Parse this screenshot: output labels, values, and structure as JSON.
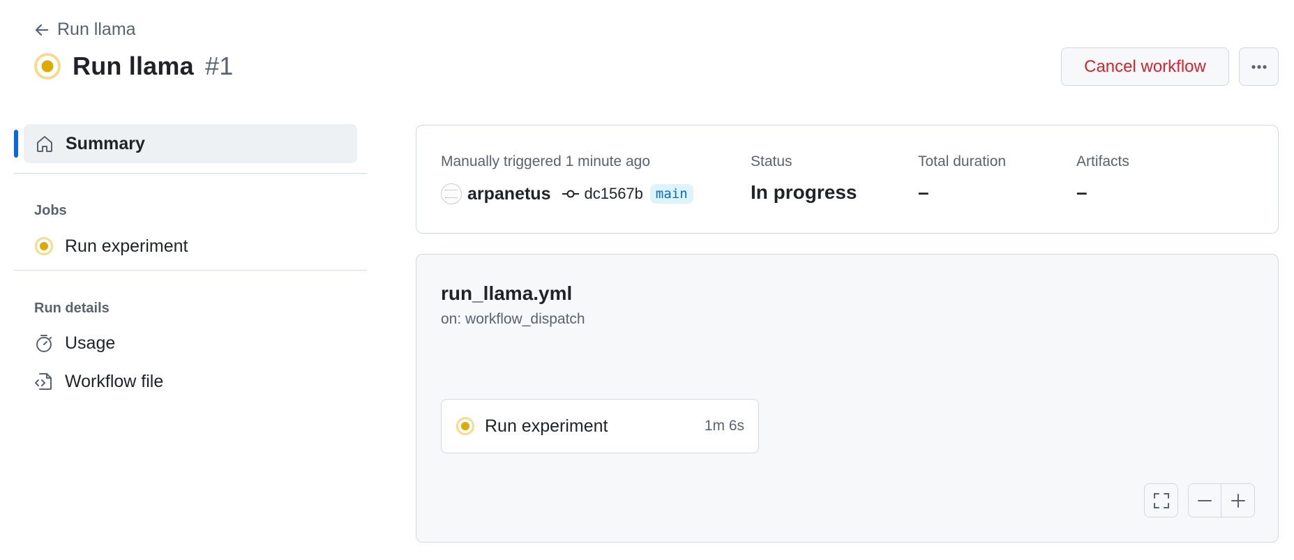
{
  "header": {
    "back_label": "Run llama",
    "title": "Run llama",
    "run_number": "#1",
    "cancel_label": "Cancel workflow",
    "status_icon": "in-progress-icon"
  },
  "sidebar": {
    "summary_label": "Summary",
    "jobs_heading": "Jobs",
    "jobs": [
      {
        "label": "Run experiment",
        "icon": "in-progress-icon"
      }
    ],
    "run_details_heading": "Run details",
    "details": [
      {
        "label": "Usage",
        "icon": "stopwatch-icon"
      },
      {
        "label": "Workflow file",
        "icon": "file-code-icon"
      }
    ]
  },
  "summary": {
    "trigger_text": "Manually triggered 1 minute ago",
    "actor": "arpanetus",
    "commit": "dc1567b",
    "branch": "main",
    "status_label": "Status",
    "status_value": "In progress",
    "duration_label": "Total duration",
    "duration_value": "–",
    "artifacts_label": "Artifacts",
    "artifacts_value": "–"
  },
  "graph": {
    "file": "run_llama.yml",
    "trigger": "on: workflow_dispatch",
    "job_name": "Run experiment",
    "job_duration": "1m 6s"
  },
  "colors": {
    "accent": "#0969da",
    "danger": "#d1242f",
    "in_progress": "#dbab0a"
  }
}
